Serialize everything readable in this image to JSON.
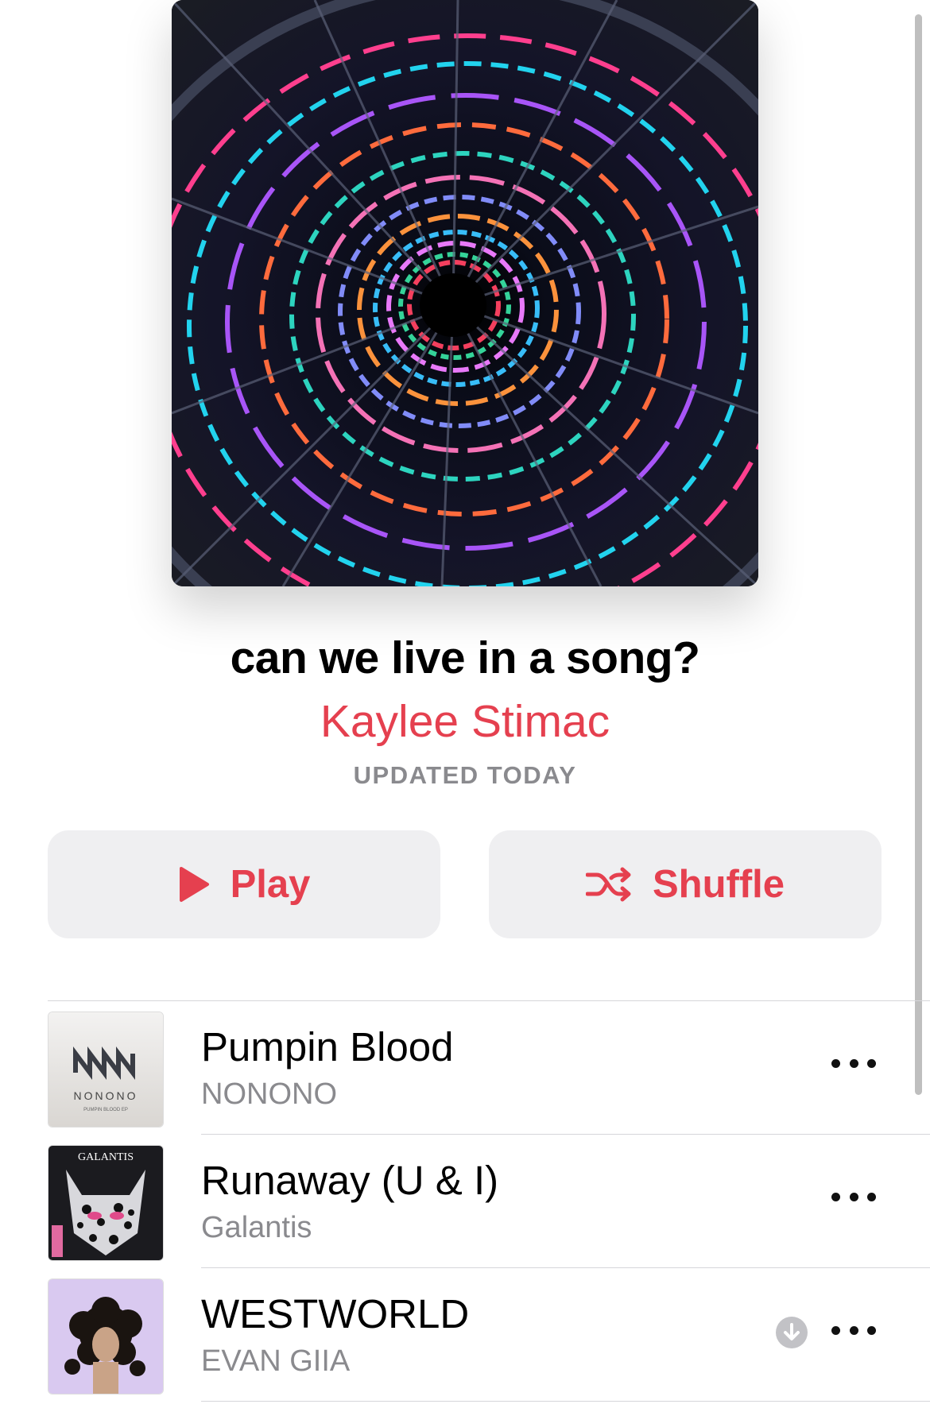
{
  "playlist": {
    "title": "can we live in a song?",
    "curator": "Kaylee Stimac",
    "updated": "UPDATED TODAY"
  },
  "actions": {
    "play_label": "Play",
    "shuffle_label": "Shuffle"
  },
  "tracks": [
    {
      "title": "Pumpin Blood",
      "artist": "NONONO",
      "cover_text": "NONONO",
      "cover_subtext": "PUMPIN BLOOD EP",
      "downloaded_icon": false
    },
    {
      "title": "Runaway (U & I)",
      "artist": "Galantis",
      "cover_text": "GALANTIS",
      "downloaded_icon": false
    },
    {
      "title": "WESTWORLD",
      "artist": "EVAN GIIA",
      "downloaded_icon": true
    }
  ],
  "colors": {
    "accent": "#e5404f",
    "secondary_text": "#8a8a8e",
    "button_bg": "#efeff1"
  },
  "icons": {
    "play": "play-icon",
    "shuffle": "shuffle-icon",
    "more": "more-icon",
    "download": "download-icon"
  }
}
